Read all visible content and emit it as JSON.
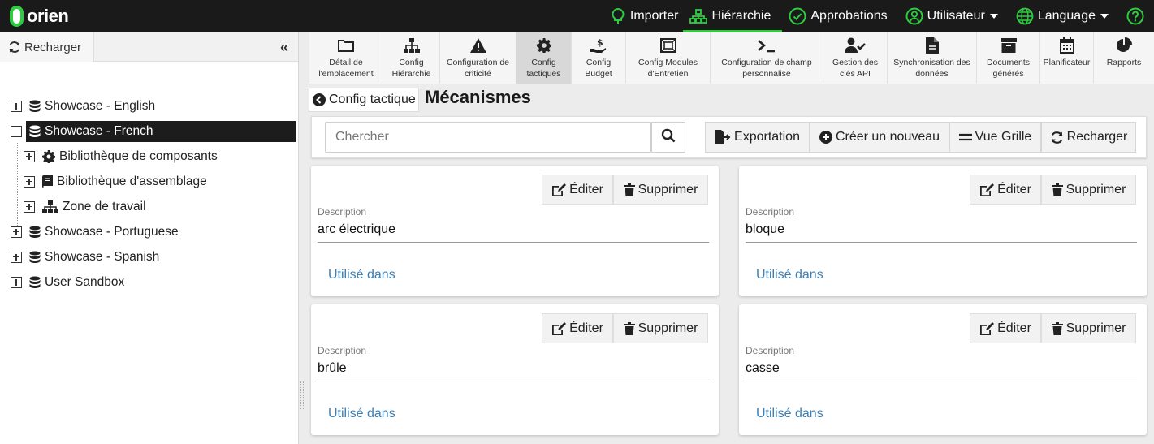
{
  "brand": {
    "name": "orien",
    "accent": "#2ecc40"
  },
  "topnav": [
    {
      "label": "Importer",
      "icon": "lightbulb-icon",
      "active": false,
      "dropdown": false
    },
    {
      "label": "Hiérarchie",
      "icon": "sitemap-icon",
      "active": true,
      "dropdown": false
    },
    {
      "label": "Approbations",
      "icon": "check-circle-icon",
      "active": false,
      "dropdown": false
    },
    {
      "label": "Utilisateur",
      "icon": "user-icon",
      "active": false,
      "dropdown": true
    },
    {
      "label": "Language",
      "icon": "globe-icon",
      "active": false,
      "dropdown": true
    },
    {
      "label": "",
      "icon": "help-icon",
      "active": false,
      "dropdown": false
    }
  ],
  "sidebar": {
    "reload_label": "Recharger",
    "tree": [
      {
        "label": "Showcase - English",
        "icon": "database-icon",
        "expanded": false,
        "selected": false,
        "level": 0
      },
      {
        "label": "Showcase - French",
        "icon": "database-icon",
        "expanded": true,
        "selected": true,
        "level": 0
      },
      {
        "label": "Bibliothèque de composants",
        "icon": "gear-icon",
        "expanded": false,
        "selected": false,
        "level": 1
      },
      {
        "label": "Bibliothèque d'assemblage",
        "icon": "book-icon",
        "expanded": false,
        "selected": false,
        "level": 1
      },
      {
        "label": "Zone de travail",
        "icon": "sitemap-icon",
        "expanded": false,
        "selected": false,
        "level": 1
      },
      {
        "label": "Showcase - Portuguese",
        "icon": "database-icon",
        "expanded": false,
        "selected": false,
        "level": 0
      },
      {
        "label": "Showcase - Spanish",
        "icon": "database-icon",
        "expanded": false,
        "selected": false,
        "level": 0
      },
      {
        "label": "User Sandbox",
        "icon": "database-icon",
        "expanded": false,
        "selected": false,
        "level": 0
      }
    ]
  },
  "toolbar": [
    {
      "line1": "Détail de",
      "line2": "l'emplacement",
      "icon": "folder-icon",
      "active": false
    },
    {
      "line1": "Config",
      "line2": "Hiérarchie",
      "icon": "sitemap-icon",
      "active": false
    },
    {
      "line1": "Configuration de",
      "line2": "criticité",
      "icon": "warning-icon",
      "active": false
    },
    {
      "line1": "Config",
      "line2": "tactiques",
      "icon": "gear-icon",
      "active": true
    },
    {
      "line1": "Config",
      "line2": "Budget",
      "icon": "budget-hand-icon",
      "active": false
    },
    {
      "line1": "Config Modules",
      "line2": "d'Entretien",
      "icon": "module-frame-icon",
      "active": false
    },
    {
      "line1": "Configuration de champ",
      "line2": "personnalisé",
      "icon": "terminal-icon",
      "active": false
    },
    {
      "line1": "Gestion des",
      "line2": "clés API",
      "icon": "user-check-icon",
      "active": false
    },
    {
      "line1": "Synchronisation des",
      "line2": "données",
      "icon": "file-sync-icon",
      "active": false
    },
    {
      "line1": "Documents",
      "line2": "générés",
      "icon": "archive-icon",
      "active": false
    },
    {
      "line1": "Planificateur",
      "line2": "",
      "icon": "calendar-icon",
      "active": false
    },
    {
      "line1": "Rapports",
      "line2": "",
      "icon": "pie-chart-icon",
      "active": false
    }
  ],
  "page": {
    "back_label": "Config tactique",
    "title": "Mécanismes"
  },
  "search": {
    "placeholder": "Chercher",
    "value": ""
  },
  "actions": {
    "export": "Exportation",
    "create": "Créer un nouveau",
    "grid": "Vue Grille",
    "reload": "Recharger"
  },
  "cards": [
    {
      "description_label": "Description",
      "description": "arc électrique",
      "edit": "Éditer",
      "delete": "Supprimer",
      "used_in": "Utilisé dans"
    },
    {
      "description_label": "Description",
      "description": "bloque",
      "edit": "Éditer",
      "delete": "Supprimer",
      "used_in": "Utilisé dans"
    },
    {
      "description_label": "Description",
      "description": "brûle",
      "edit": "Éditer",
      "delete": "Supprimer",
      "used_in": "Utilisé dans"
    },
    {
      "description_label": "Description",
      "description": "casse",
      "edit": "Éditer",
      "delete": "Supprimer",
      "used_in": "Utilisé dans"
    }
  ]
}
